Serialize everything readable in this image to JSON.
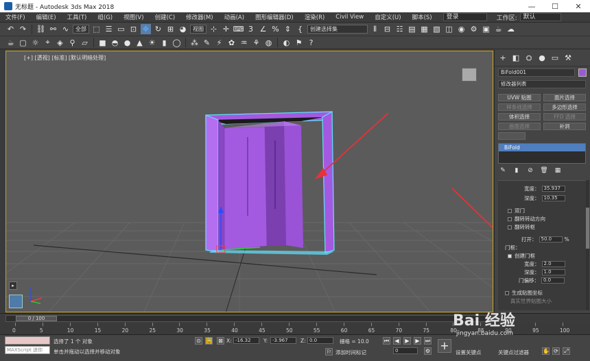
{
  "titlebar": {
    "title": "无标题 - Autodesk 3ds Max 2018",
    "min": "—",
    "max": "☐",
    "close": "✕"
  },
  "menubar": {
    "items": [
      "文件(F)",
      "编辑(E)",
      "工具(T)",
      "组(G)",
      "视图(V)",
      "创建(C)",
      "修改器(M)",
      "动画(A)",
      "图形编辑器(D)",
      "渲染(R)",
      "Civil View",
      "自定义(U)",
      "脚本(S)"
    ],
    "login": "登录",
    "workspace_label": "工作区:",
    "workspace_value": "默认"
  },
  "toolbar1": {
    "filter": "全部",
    "refcoord": "视图",
    "selset": "创建选择集"
  },
  "viewport": {
    "label": "[+] [透视] [标准] [默认明暗处理]",
    "left_btn": "▸"
  },
  "cmdpanel": {
    "object_name": "BiFold001",
    "object_color": "#9b59d6",
    "modifier_list": "修改器列表",
    "buttons": [
      "UVW 贴图",
      "面片选择",
      "样条线选择",
      "多边形选择",
      "体积选择",
      "FFD 选择",
      "曲面选择",
      "补洞"
    ],
    "stack_item": "BiFold",
    "params": {
      "width_label": "宽度：",
      "width_value": "35.937",
      "depth_label": "深度：",
      "depth_value": "10.35",
      "double_door": "双门",
      "flip_swing": "翻转转动方向",
      "flip_hinge": "翻转转枢",
      "open_label": "打开：",
      "open_value": "50.0",
      "open_unit": "%",
      "frame_group": "门框：",
      "create_frame": "创建门框",
      "frame_width_label": "宽度：",
      "frame_width_value": "2.0",
      "frame_depth_label": "深度：",
      "frame_depth_value": "1.0",
      "frame_offset_label": "门偏移：",
      "frame_offset_value": "0.0",
      "gen_map": "生成贴图坐标",
      "real_world": "真实世界贴图大小"
    }
  },
  "timeline": {
    "thumb": "0 / 100",
    "ticks": [
      "0",
      "5",
      "10",
      "15",
      "20",
      "25",
      "30",
      "35",
      "40",
      "45",
      "50",
      "55",
      "60",
      "65",
      "70",
      "75",
      "80",
      "85",
      "90",
      "95",
      "100"
    ]
  },
  "status": {
    "selected": "选择了 1 个 对象",
    "hint": "单击并拖动以选择并移动对象",
    "maxscript": "MAXScript 迷你",
    "x_label": "X:",
    "x_value": "-16.32",
    "y_label": "Y:",
    "y_value": "-3.967",
    "z_label": "Z:",
    "z_value": "0.0",
    "grid": "栅格 = 10.0",
    "add_time_tag": "添加时间标记",
    "set_key": "设置关键点",
    "key_filter": "关键点过滤器",
    "frame": "0"
  },
  "watermark": {
    "brand": "Bai 经验",
    "url": "jingyan.baidu.com"
  },
  "colors": {
    "door": "#a35ae0",
    "door_dark": "#7b3fb0",
    "selection": "#5fe3ff",
    "arrow": "#e8313a",
    "accent": "#c9a21b"
  }
}
